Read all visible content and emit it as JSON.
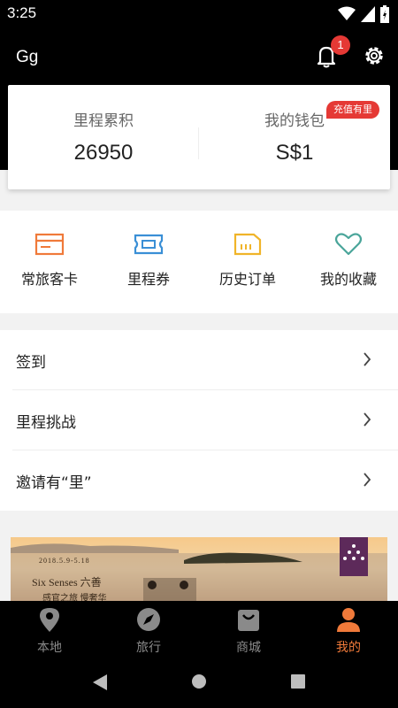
{
  "status_bar": {
    "time": "3:25"
  },
  "header": {
    "username": "Gg",
    "notification_count": "1"
  },
  "account_card": {
    "mileage_label": "里程累积",
    "mileage_value": "26950",
    "wallet_label": "我的钱包",
    "wallet_value": "S$1",
    "topup_badge": "充值有里"
  },
  "quick_actions": [
    {
      "label": "常旅客卡",
      "icon": "card-icon",
      "color": "#f07a3a"
    },
    {
      "label": "里程券",
      "icon": "ticket-icon",
      "color": "#3a8fd6"
    },
    {
      "label": "历史订单",
      "icon": "receipt-icon",
      "color": "#f0b429"
    },
    {
      "label": "我的收藏",
      "icon": "heart-icon",
      "color": "#4aa59a"
    }
  ],
  "menu": [
    {
      "label": "签到"
    },
    {
      "label": "里程挑战"
    },
    {
      "label": "邀请有“里”"
    }
  ],
  "banner": {
    "date_text": "2018.5.9-5.18",
    "title_text": "Six Senses 六善",
    "subtitle_text": "感官之旅 慢奢华"
  },
  "tabs": [
    {
      "label": "本地",
      "icon": "location-pin-icon",
      "active": false
    },
    {
      "label": "旅行",
      "icon": "compass-icon",
      "active": false
    },
    {
      "label": "商城",
      "icon": "shopping-bag-icon",
      "active": false
    },
    {
      "label": "我的",
      "icon": "person-icon",
      "active": true
    }
  ],
  "colors": {
    "accent": "#f07a3a",
    "badge": "#e53935",
    "tab_inactive": "#8a8a8a"
  }
}
